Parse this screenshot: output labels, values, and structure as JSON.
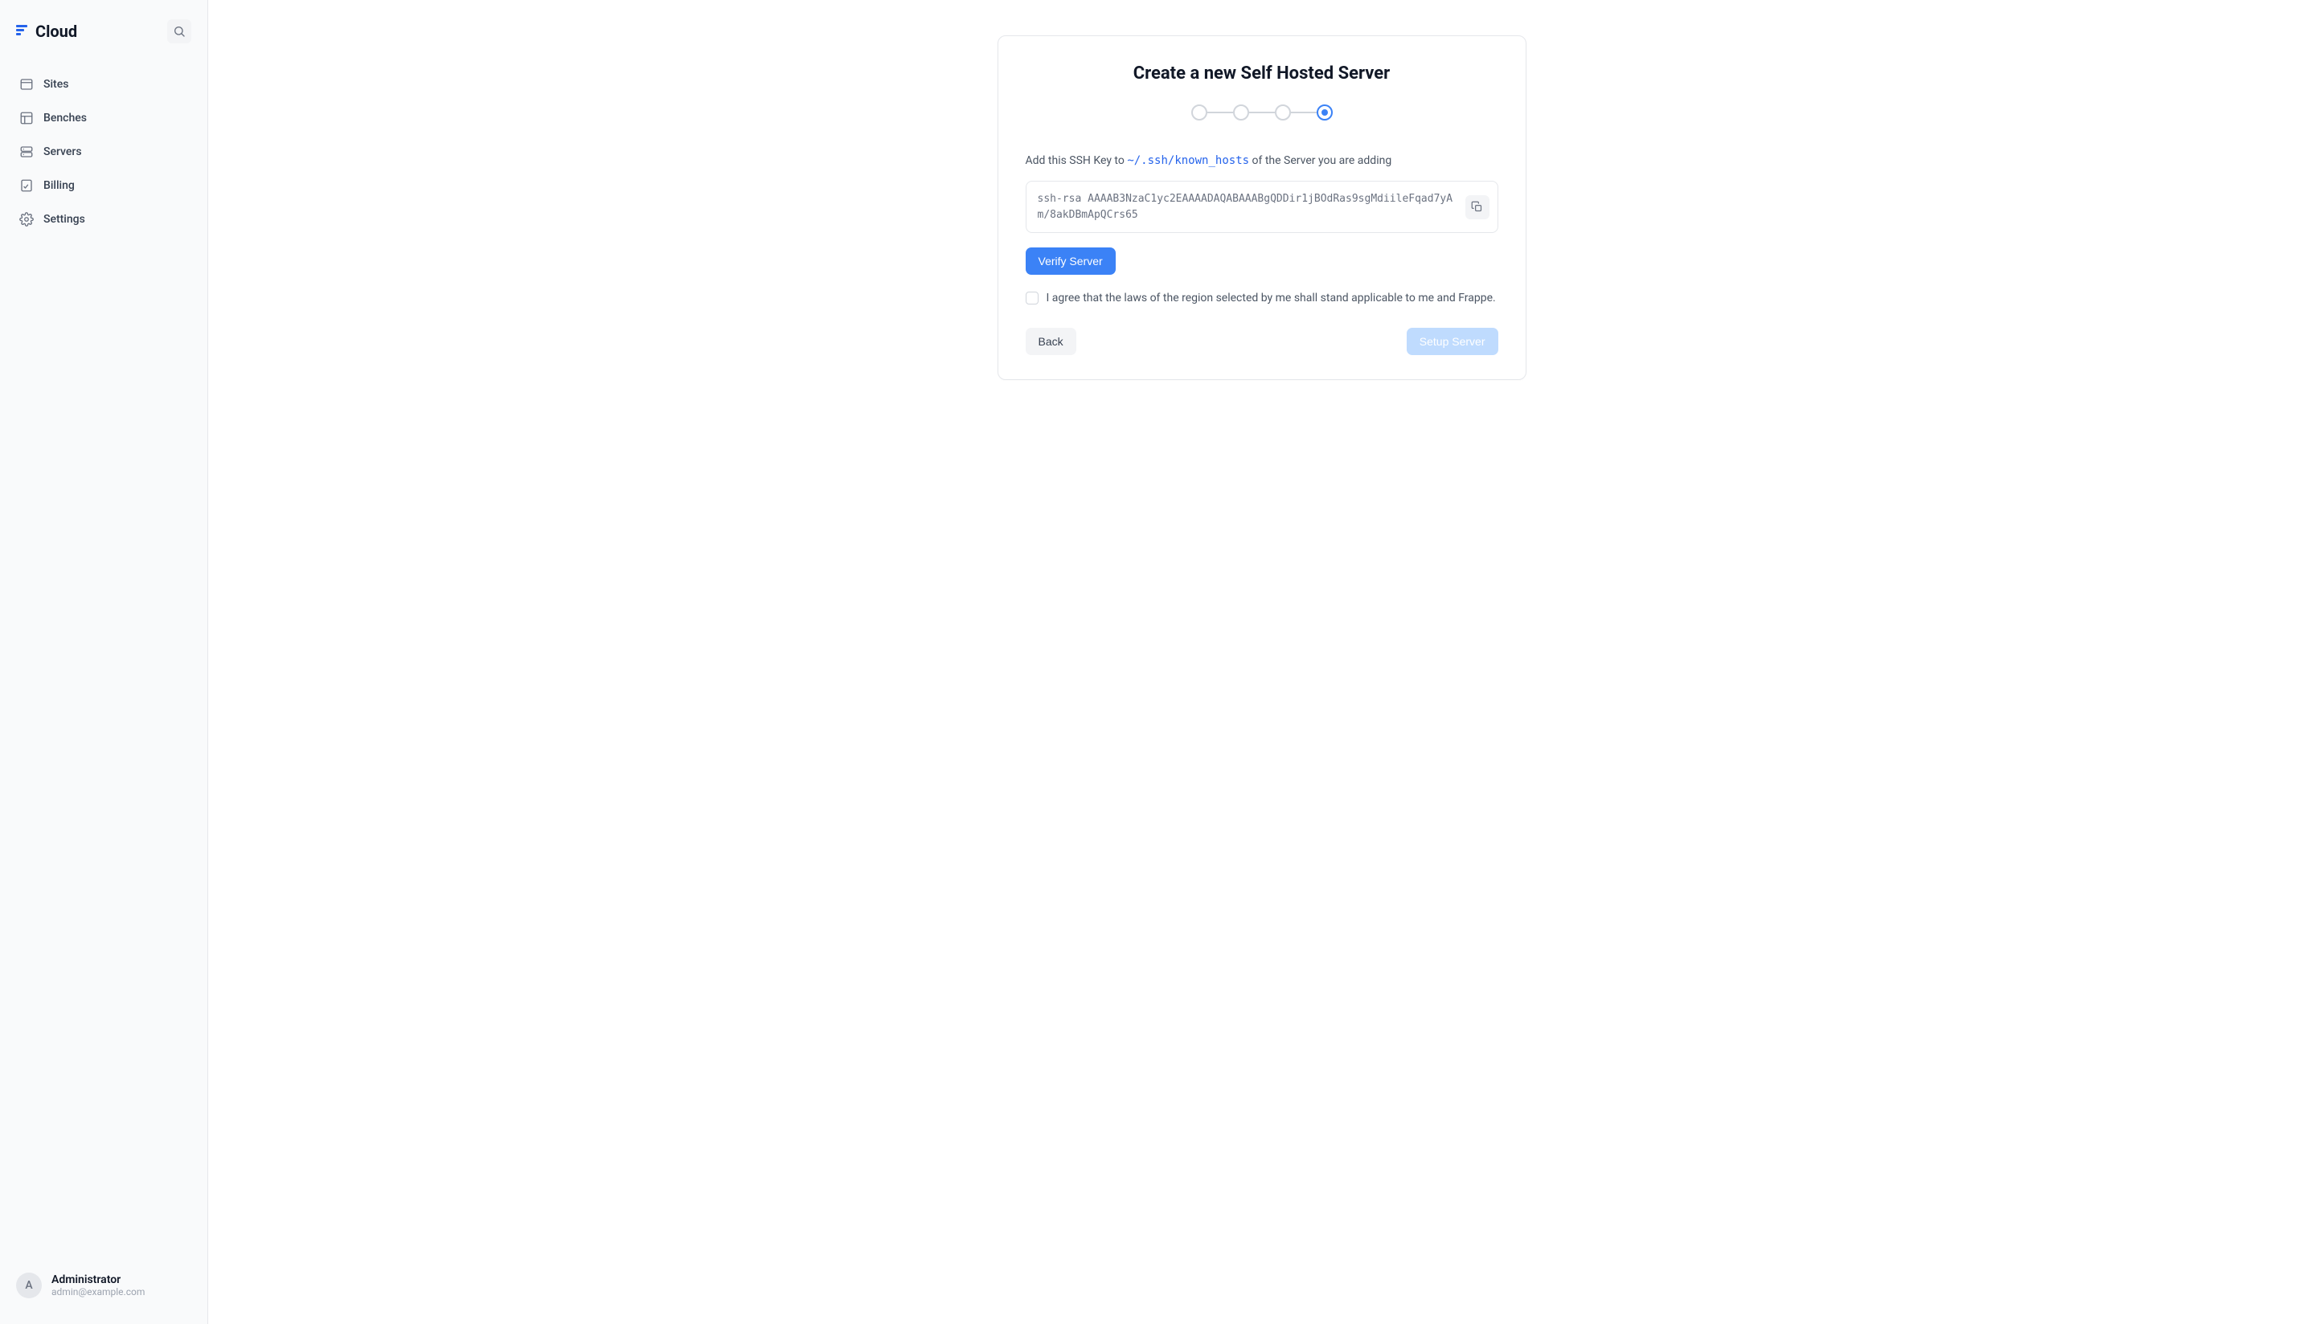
{
  "app": {
    "name": "Cloud"
  },
  "sidebar": {
    "items": [
      {
        "label": "Sites"
      },
      {
        "label": "Benches"
      },
      {
        "label": "Servers"
      },
      {
        "label": "Billing"
      },
      {
        "label": "Settings"
      }
    ]
  },
  "user": {
    "initial": "A",
    "name": "Administrator",
    "email": "admin@example.com"
  },
  "card": {
    "title": "Create a new Self Hosted Server",
    "instruction_pre": "Add this SSH Key to ",
    "instruction_code": "~/.ssh/known_hosts",
    "instruction_post": " of the Server you are adding",
    "ssh_key": "ssh-rsa AAAAB3NzaC1yc2EAAAADAQABAAABgQDDir1jBOdRas9sgMdiileFqad7yAm/8akDBmApQCrs65",
    "verify_button": "Verify Server",
    "agree_label": "I agree that the laws of the region selected by me shall stand applicable to me and Frappe.",
    "back_button": "Back",
    "setup_button": "Setup Server"
  }
}
